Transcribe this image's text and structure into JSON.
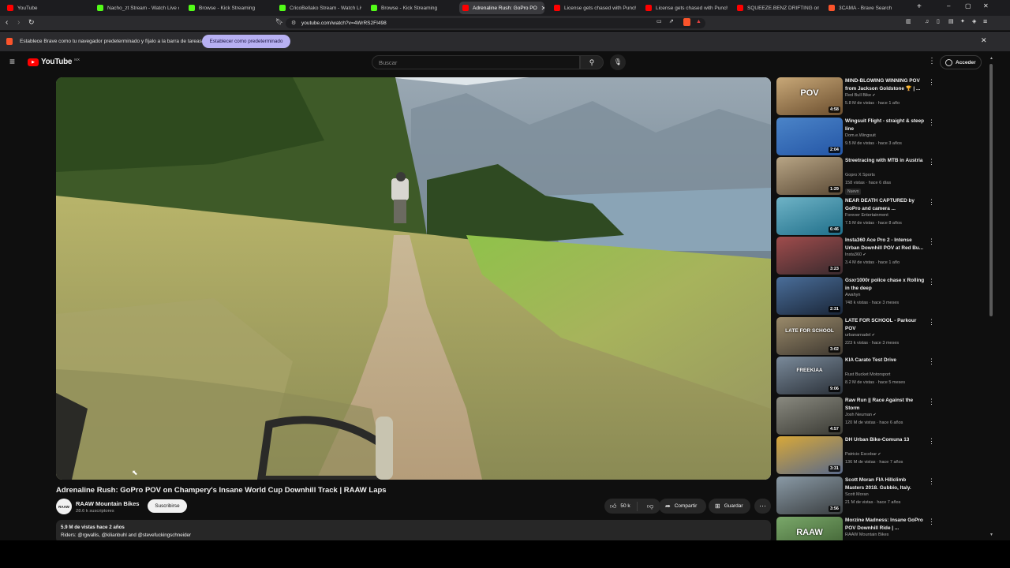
{
  "browser": {
    "tabs": [
      {
        "label": "YouTube",
        "color": "#ff0000"
      },
      {
        "label": "Nacho_zt Stream - Watch Live on",
        "color": "#53fc18"
      },
      {
        "label": "Browse - Kick Streaming",
        "color": "#53fc18"
      },
      {
        "label": "CricoBellako Stream - Watch Live o",
        "color": "#53fc18"
      },
      {
        "label": "Browse - Kick Streaming",
        "color": "#53fc18"
      },
      {
        "label": "Adrenaline Rush: GoPro PO",
        "color": "#ff0000",
        "active": true
      },
      {
        "label": "License gets chased with Punchma",
        "color": "#ff0000"
      },
      {
        "label": "License gets chased with Punchma",
        "color": "#ff0000"
      },
      {
        "label": "SQUEEZE.BENZ DRIFTING on TIME",
        "color": "#ff0000"
      },
      {
        "label": "3CAMA - Brave Search",
        "color": "#fb542b"
      }
    ],
    "url": "youtube.com/watch?v=4WrRS2FI498",
    "infobar": {
      "text": "Establece Brave como tu navegador predeterminado y fíjalo a la barra de tareas",
      "button": "Establecer como predeterminado"
    }
  },
  "youtube": {
    "logo": "YouTube",
    "country": "MX",
    "search_placeholder": "Buscar",
    "signin": "Acceder",
    "video": {
      "title": "Adrenaline Rush: GoPro POV on Champery's Insane World Cup Downhill Track | RAAW Laps",
      "channel": "RAAW Mountain Bikes",
      "channel_avatar": "RAAW",
      "subscribers": "28.6 k suscriptores",
      "subscribe": "Suscribirse",
      "likes": "50 k",
      "share": "Compartir",
      "save": "Guardar",
      "desc_line1": "5.9 M de vistas  hace 2 años",
      "desc_line2": "Riders: @rgwallis, @kilianbuhl and @stevefuckingschneider"
    },
    "recommendations": [
      {
        "title": "MIND-BLOWING WINNING POV from Jackson Goldstone 🏆 | ...",
        "channel": "Red Bull Bike",
        "verified": true,
        "meta": "5.8 M de vistas · hace 1 año",
        "duration": "4:58",
        "overlay": "POV",
        "thumb": [
          "#c8a878",
          "#6b4e2e"
        ]
      },
      {
        "title": "Wingsuit Flight - straight & steep line",
        "channel": "Dom.e.Wingsuit",
        "verified": false,
        "meta": "9.5 M de vistas · hace 3 años",
        "duration": "2:04",
        "overlay": "",
        "thumb": [
          "#4b84c8",
          "#2456a6"
        ]
      },
      {
        "title": "Streetracing with MTB in Austria",
        "channel": "Gopro X Sports",
        "verified": false,
        "meta": "158 vistas · hace 6 días",
        "duration": "1:29",
        "overlay": "",
        "badge": "Nuevo",
        "thumb": [
          "#b8a585",
          "#5b4a36"
        ]
      },
      {
        "title": "NEAR DEATH CAPTURED by GoPro and camera ...",
        "channel": "Forever Entertainment",
        "verified": false,
        "meta": "7.5 M de vistas · hace 8 años",
        "duration": "6:46",
        "overlay": "",
        "thumb": [
          "#6fb3c6",
          "#1f6f8a"
        ]
      },
      {
        "title": "Insta360 Ace Pro 2 - Intense Urban Downhill POV at Red Bu...",
        "channel": "Insta360",
        "verified": true,
        "meta": "3.4 M de vistas · hace 1 año",
        "duration": "3:23",
        "overlay": "",
        "thumb": [
          "#a04c4c",
          "#3a2a2e"
        ]
      },
      {
        "title": "Gsxr1000r police chase x Rolling in the deep",
        "channel": "Awahyn",
        "verified": false,
        "meta": "748 k vistas · hace 3 meses",
        "duration": "2:31",
        "overlay": "",
        "thumb": [
          "#4a6e9a",
          "#1a2638"
        ]
      },
      {
        "title": "LATE FOR SCHOOL - Parkour POV",
        "channel": "urbanarnadel",
        "verified": true,
        "meta": "223 k vistas · hace 3 meses",
        "duration": "3:02",
        "overlay": "LATE FOR SCHOOL",
        "thumb": [
          "#9a8a6a",
          "#3e3830"
        ]
      },
      {
        "title": "KIA Carato Test Drive",
        "channel": "Rust Bucket Motorsport",
        "verified": false,
        "meta": "8.2 M de vistas · hace 5 meses",
        "duration": "9:06",
        "overlay": "FREEKIAA",
        "thumb": [
          "#7a8a9a",
          "#2a3038"
        ]
      },
      {
        "title": "Raw Run || Race Against the Storm",
        "channel": "Josh Neuman",
        "verified": true,
        "meta": "120 M de vistas · hace 6 años",
        "duration": "4:57",
        "overlay": "",
        "thumb": [
          "#8a8a80",
          "#3a3a34"
        ]
      },
      {
        "title": "DH Urban Bike-Comuna 13",
        "channel": "Patricio Escobar",
        "verified": true,
        "meta": "136 M de vistas · hace 7 años",
        "duration": "3:31",
        "overlay": "",
        "thumb": [
          "#d8a838",
          "#5a6a8a"
        ]
      },
      {
        "title": "Scott Moran FIA Hillclimb Masters 2018. Gubbio, Italy.",
        "channel": "Scott Moran",
        "verified": false,
        "meta": "21 M de vistas · hace 7 años",
        "duration": "3:56",
        "overlay": "",
        "thumb": [
          "#8a9aa6",
          "#3a3e40"
        ]
      },
      {
        "title": "Morzine Madness: Insane GoPro POV Downhill Ride | ...",
        "channel": "RAAW Mountain Bikes",
        "verified": false,
        "meta": "",
        "duration": "",
        "overlay": "RAAW",
        "thumb": [
          "#7aa86a",
          "#3a5a2e"
        ]
      }
    ]
  }
}
